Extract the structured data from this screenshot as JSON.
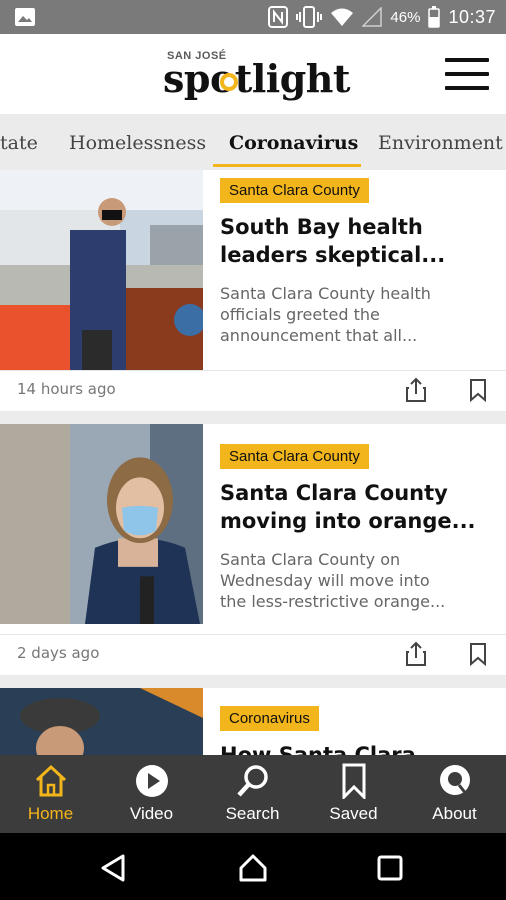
{
  "status_bar": {
    "battery_percent": "46%",
    "time": "10:37",
    "icons": [
      "image-icon",
      "nfc-icon",
      "vibrate-icon",
      "wifi-icon",
      "signal-icon",
      "battery-icon"
    ]
  },
  "header": {
    "logo_small": "SAN JOSÉ",
    "logo_main": "spotlight",
    "menu_icon": "hamburger-icon"
  },
  "tabs": [
    {
      "label": "tate"
    },
    {
      "label": "Homelessness"
    },
    {
      "label": "Coronavirus"
    },
    {
      "label": "Environment"
    }
  ],
  "articles": [
    {
      "category": "Santa Clara County",
      "headline": "South Bay health leaders skeptical...",
      "headline_lines": [
        "South Bay health",
        "leaders skeptical..."
      ],
      "excerpt_lines": [
        "Santa Clara County health",
        "officials greeted the",
        "announcement that all..."
      ],
      "time": "14 hours ago"
    },
    {
      "category": "Santa Clara County",
      "headline_lines": [
        "Santa Clara County",
        "moving into orange..."
      ],
      "excerpt_lines": [
        "Santa Clara County on",
        "Wednesday will move into",
        "the less-restrictive orange..."
      ],
      "time": "2 days ago"
    },
    {
      "category": "Coronavirus",
      "headline_lines": [
        "How Santa Clara"
      ]
    }
  ],
  "bottom_nav": [
    {
      "label": "Home",
      "icon": "home-icon"
    },
    {
      "label": "Video",
      "icon": "play-icon"
    },
    {
      "label": "Search",
      "icon": "search-icon"
    },
    {
      "label": "Saved",
      "icon": "bookmark-icon"
    },
    {
      "label": "About",
      "icon": "chat-icon"
    }
  ],
  "colors": {
    "accent": "#f3b51c",
    "nav_bg": "#3c3c3c",
    "status_bg": "#7a7a7a"
  }
}
